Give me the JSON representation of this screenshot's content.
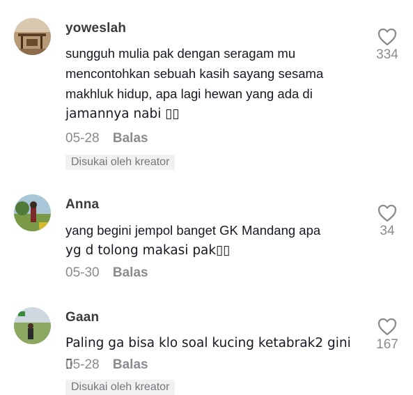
{
  "comments": [
    {
      "username": "yoweslah",
      "lines": [
        "sungguh mulia pak dengan seragam mu",
        "mencontohkan sebuah kasih sayang sesama",
        "makhluk hidup, apa lagi hewan yang ada di",
        "jamannya nabi ▯▯"
      ],
      "date": "05-28",
      "reply": "Balas",
      "badge": "Disukai oleh kreator",
      "likes": "334",
      "avatar_icon": "photo-avatar-room"
    },
    {
      "username": "Anna",
      "lines": [
        "yang begini jempol banget GK Mandang apa",
        "yg d tolong makasi pak▯▯"
      ],
      "date": "05-30",
      "reply": "Balas",
      "likes": "34",
      "avatar_icon": "photo-avatar-person-outdoor"
    },
    {
      "username": "Gaan",
      "lines": [
        "Paling ga bisa klo soal kucing ketabrak2 gini ▯"
      ],
      "date": "05-28",
      "reply": "Balas",
      "badge": "Disukai oleh kreator",
      "likes": "167",
      "avatar_icon": "photo-avatar-field"
    }
  ],
  "colors": {
    "text": "#161823",
    "muted": "#8a8b91",
    "badge_bg": "#f1f1f2"
  }
}
